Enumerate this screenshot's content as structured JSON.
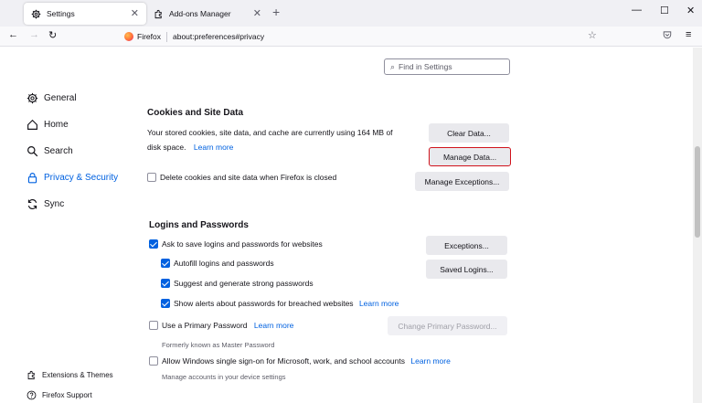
{
  "tabs": [
    {
      "label": "Settings",
      "active": true,
      "icon": "gear-icon"
    },
    {
      "label": "Add-ons Manager",
      "active": false,
      "icon": "puzzle-icon"
    }
  ],
  "window_controls": {
    "minimize": "—",
    "maximize": "☐",
    "close": "✕"
  },
  "nav": {
    "back": "←",
    "forward": "→",
    "reload": "↻",
    "brand": "Firefox",
    "url": "about:preferences#privacy",
    "star": "☆",
    "menu": "≡"
  },
  "search": {
    "placeholder": "Find in Settings"
  },
  "sidebar": {
    "items": [
      {
        "label": "General",
        "icon": "gear-icon"
      },
      {
        "label": "Home",
        "icon": "home-icon"
      },
      {
        "label": "Search",
        "icon": "search-icon"
      },
      {
        "label": "Privacy & Security",
        "icon": "lock-icon",
        "active": true
      },
      {
        "label": "Sync",
        "icon": "sync-icon"
      }
    ],
    "footer": [
      {
        "label": "Extensions & Themes",
        "icon": "puzzle-icon"
      },
      {
        "label": "Firefox Support",
        "icon": "help-icon"
      }
    ]
  },
  "cookies": {
    "heading": "Cookies and Site Data",
    "desc_line1": "Your stored cookies, site data, and cache are currently using 164 MB of",
    "desc_line2": "disk space.",
    "learn_more": "Learn more",
    "clear_button": "Clear Data...",
    "manage_button": "Manage Data...",
    "delete_label": "Delete cookies and site data when Firefox is closed",
    "delete_checked": false,
    "exceptions_button": "Manage Exceptions..."
  },
  "logins": {
    "heading": "Logins and Passwords",
    "ask_label": "Ask to save logins and passwords for websites",
    "autofill_label": "Autofill logins and passwords",
    "suggest_label": "Suggest and generate strong passwords",
    "alerts_label": "Show alerts about passwords for breached websites",
    "alerts_learn_more": "Learn more",
    "exceptions_button": "Exceptions...",
    "saved_button": "Saved Logins...",
    "primary_label": "Use a Primary Password",
    "primary_learn_more": "Learn more",
    "change_primary_button": "Change Primary Password...",
    "primary_note": "Formerly known as Master Password",
    "sso_label": "Allow Windows single sign-on for Microsoft, work, and school accounts",
    "sso_learn_more": "Learn more",
    "sso_note": "Manage accounts in your device settings"
  },
  "colors": {
    "accent": "#0061e0",
    "highlight": "#d0121b"
  }
}
